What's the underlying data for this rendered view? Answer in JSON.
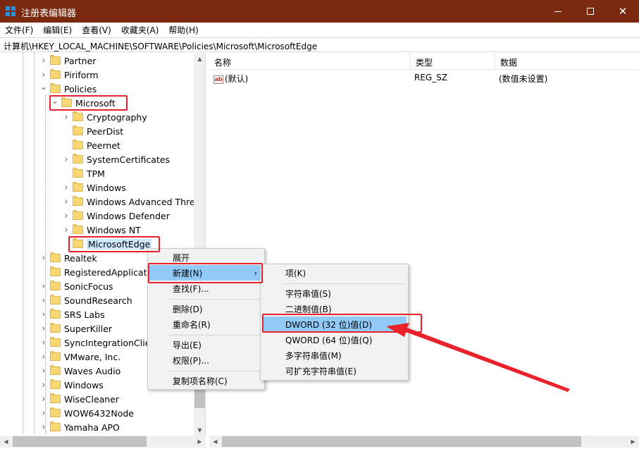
{
  "window": {
    "title": "注册表编辑器",
    "icon": "regedit-icon"
  },
  "menubar": {
    "items": [
      "文件(F)",
      "编辑(E)",
      "查看(V)",
      "收藏夹(A)",
      "帮助(H)"
    ]
  },
  "address": {
    "path": "计算机\\HKEY_LOCAL_MACHINE\\SOFTWARE\\Policies\\Microsoft\\MicrosoftEdge"
  },
  "tree": {
    "items": [
      {
        "label": "Partner",
        "expander": "collapsed"
      },
      {
        "label": "Piriform",
        "expander": "collapsed"
      },
      {
        "label": "Policies",
        "expander": "expanded"
      },
      {
        "label": "Microsoft",
        "expander": "expanded"
      },
      {
        "label": "Cryptography",
        "expander": "collapsed"
      },
      {
        "label": "PeerDist",
        "expander": "none"
      },
      {
        "label": "Peernet",
        "expander": "none"
      },
      {
        "label": "SystemCertificates",
        "expander": "collapsed"
      },
      {
        "label": "TPM",
        "expander": "none"
      },
      {
        "label": "Windows",
        "expander": "collapsed"
      },
      {
        "label": "Windows Advanced Threa",
        "expander": "collapsed"
      },
      {
        "label": "Windows Defender",
        "expander": "collapsed"
      },
      {
        "label": "Windows NT",
        "expander": "collapsed"
      },
      {
        "label": "MicrosoftEdge",
        "expander": "none"
      },
      {
        "label": "Realtek",
        "expander": "collapsed"
      },
      {
        "label": "RegisteredApplicatio",
        "expander": "none"
      },
      {
        "label": "SonicFocus",
        "expander": "collapsed"
      },
      {
        "label": "SoundResearch",
        "expander": "collapsed"
      },
      {
        "label": "SRS Labs",
        "expander": "collapsed"
      },
      {
        "label": "SuperKiller",
        "expander": "collapsed"
      },
      {
        "label": "SyncIntegrationClien",
        "expander": "collapsed"
      },
      {
        "label": "VMware, Inc.",
        "expander": "collapsed"
      },
      {
        "label": "Waves Audio",
        "expander": "collapsed"
      },
      {
        "label": "Windows",
        "expander": "collapsed"
      },
      {
        "label": "WiseCleaner",
        "expander": "collapsed"
      },
      {
        "label": "WOW6432Node",
        "expander": "collapsed"
      },
      {
        "label": "Yamaha APO",
        "expander": "collapsed"
      }
    ]
  },
  "list": {
    "columns": [
      "名称",
      "类型",
      "数据"
    ],
    "rows": [
      {
        "name": "(默认)",
        "type": "REG_SZ",
        "data": "(数值未设置)",
        "icon": "string-value-icon"
      }
    ]
  },
  "context_menu": {
    "header": "展开",
    "items": [
      "新建(N)",
      "查找(F)...",
      "删除(D)",
      "重命名(R)",
      "导出(E)",
      "权限(P)...",
      "复制项名称(C)"
    ]
  },
  "submenu": {
    "items": [
      "项(K)",
      "字符串值(S)",
      "二进制值(B)",
      "DWORD (32 位)值(D)",
      "QWORD (64 位)值(Q)",
      "多字符串值(M)",
      "可扩充字符串值(E)"
    ]
  },
  "colors": {
    "titlebar": "#7a2a0e",
    "highlight": "#91c9f7",
    "annotation_red": "#e8212a",
    "folder": "#f8d775"
  }
}
